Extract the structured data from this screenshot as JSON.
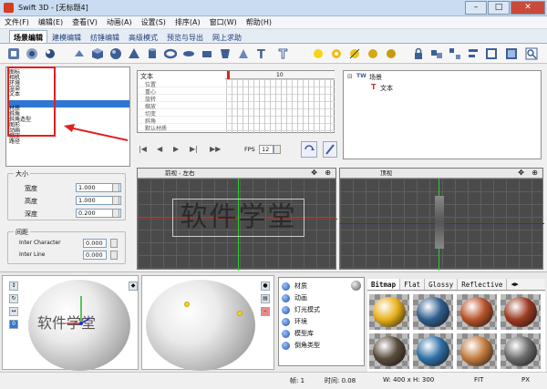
{
  "window": {
    "title": "Swift 3D - [无标题4]"
  },
  "menu": [
    "文件(F)",
    "编辑(E)",
    "查看(V)",
    "动画(A)",
    "设置(S)",
    "排序(A)",
    "窗口(W)",
    "帮助(H)"
  ],
  "tabs": [
    "场景编辑",
    "建模编辑",
    "纺锤编辑",
    "高级模式",
    "预览与导出",
    "网上求助"
  ],
  "property_list": [
    "图标",
    "相机",
    "环境",
    "渲染",
    "文本",
    "材质",
    "斜角",
    "斜角造型",
    "图形",
    "动画",
    "缩放",
    "路径"
  ],
  "size_group": {
    "label": "大小",
    "fields": [
      {
        "label": "宽度",
        "value": "1.000"
      },
      {
        "label": "高度",
        "value": "1.000"
      },
      {
        "label": "深度",
        "value": "0.200"
      }
    ]
  },
  "spacing_group": {
    "label": "间距",
    "fields": [
      {
        "label": "Inter Character",
        "value": "0.000"
      },
      {
        "label": "Inter Line",
        "value": "0.000"
      }
    ]
  },
  "timeline": {
    "object": "文本",
    "ruler_mark": "10",
    "tracks": [
      "位置",
      "重心",
      "旋转",
      "缩放",
      "切变",
      "斜角",
      "默认材质"
    ],
    "fps_label": "FPS",
    "fps_value": "12"
  },
  "scene_tree": {
    "root": "场景",
    "child": "文本"
  },
  "viewports": [
    {
      "label": "前视 - 左右"
    },
    {
      "label": "顶视"
    }
  ],
  "viewport_text": "软件学堂",
  "material_panel": {
    "items": [
      "材质",
      "动画",
      "灯光模式",
      "环境",
      "模型库",
      "倒角类型"
    ]
  },
  "material_tabs": [
    "Bitmap",
    "Flat",
    "Glossy",
    "Reflective"
  ],
  "material_swatches": [
    {
      "color": "#e8b019"
    },
    {
      "color": "#2f5f8e"
    },
    {
      "color": "#b8532a"
    },
    {
      "color": "#9c3a22"
    },
    {
      "color": "#5a4c3c"
    },
    {
      "color": "#2f6fa6"
    },
    {
      "color": "#c37a3e"
    },
    {
      "color": "#6b6b6b"
    }
  ],
  "status": {
    "frame": "帧: 1",
    "time": "时间: 0.08",
    "size": "W: 400 x H: 300",
    "fit": "FIT",
    "px": "PX"
  },
  "colors": {
    "accent": "#3076d4",
    "annotation": "#e0201f"
  }
}
